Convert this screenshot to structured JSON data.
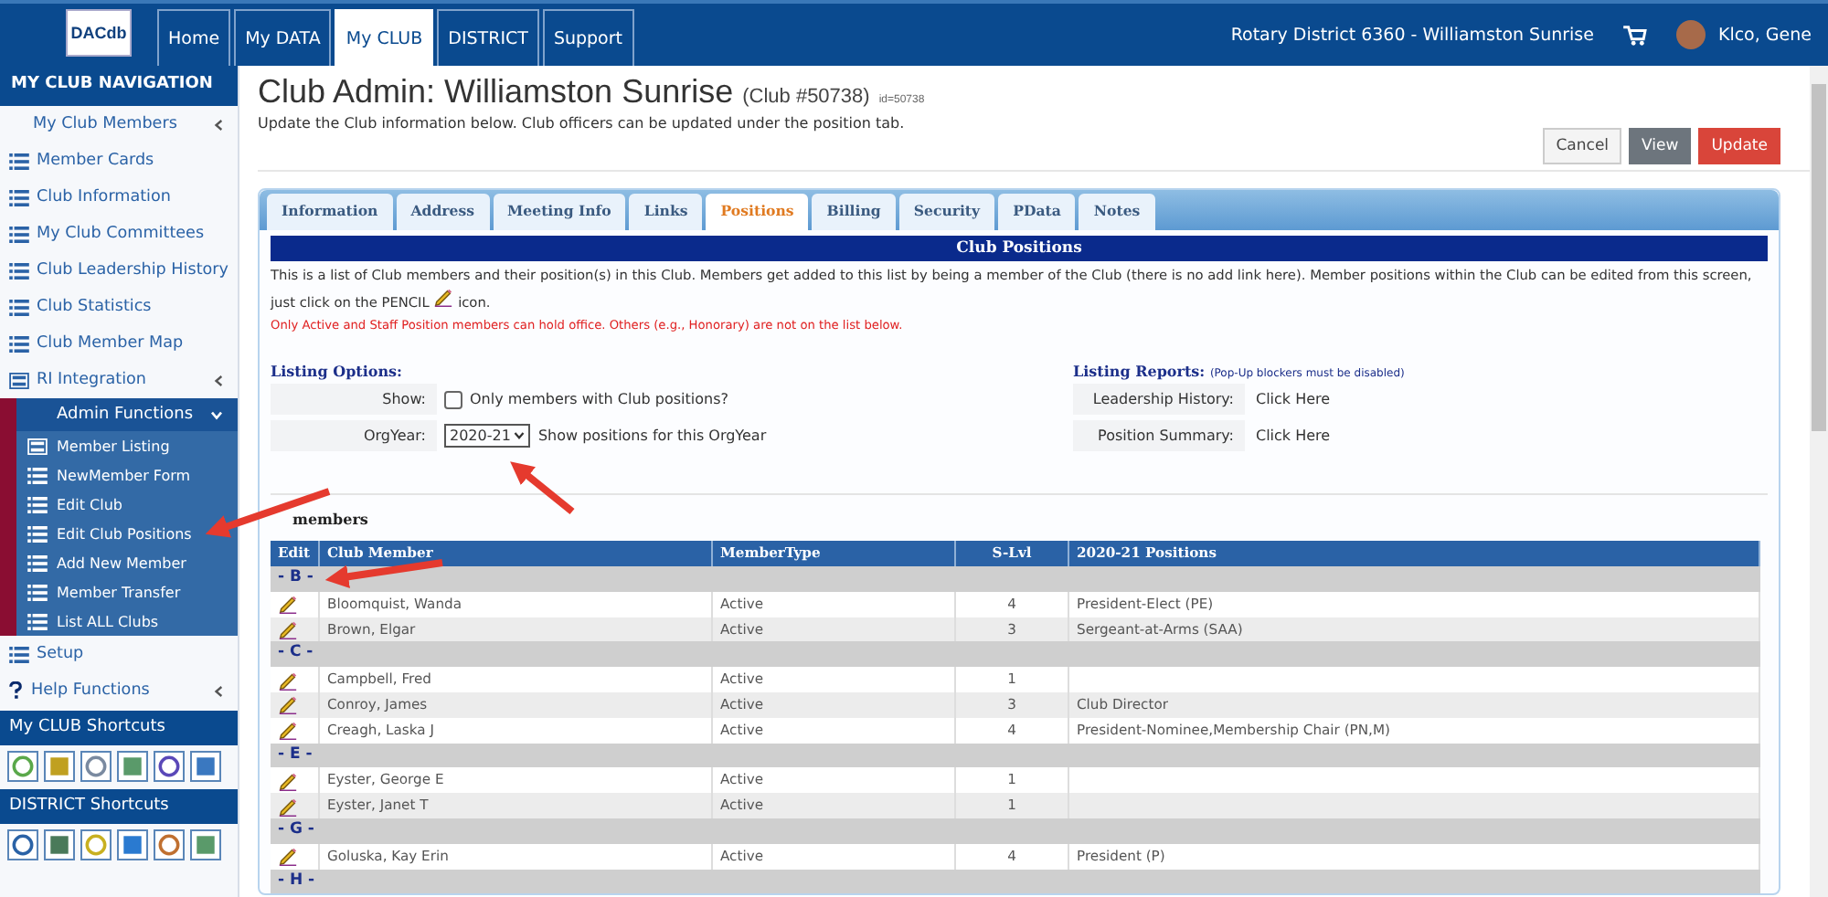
{
  "topbar": {
    "logo": "DACdb",
    "nav": [
      {
        "label": "Home",
        "selected": false
      },
      {
        "label": "My DATA",
        "selected": false
      },
      {
        "label": "My CLUB",
        "selected": true
      },
      {
        "label": "DISTRICT",
        "selected": false
      },
      {
        "label": "Support",
        "selected": false
      }
    ],
    "context": "Rotary District 6360 - Williamston Sunrise",
    "user": "Klco, Gene"
  },
  "sidebar": {
    "heading": "MY CLUB NAVIGATION",
    "items": [
      {
        "label": "My Club Members",
        "kind": "parent"
      },
      {
        "label": "Member Cards",
        "kind": "list"
      },
      {
        "label": "Club Information",
        "kind": "list"
      },
      {
        "label": "My Club Committees",
        "kind": "list"
      },
      {
        "label": "Club Leadership History",
        "kind": "list"
      },
      {
        "label": "Club Statistics",
        "kind": "list"
      },
      {
        "label": "Club Member Map",
        "kind": "list"
      },
      {
        "label": "RI Integration",
        "kind": "card-parent"
      },
      {
        "label": "Admin Functions",
        "kind": "group",
        "expanded": true,
        "children": [
          {
            "label": "Member Listing",
            "kind": "card"
          },
          {
            "label": "NewMember Form",
            "kind": "list"
          },
          {
            "label": "Edit Club",
            "kind": "list"
          },
          {
            "label": "Edit Club Positions",
            "kind": "list"
          },
          {
            "label": "Add New Member",
            "kind": "list"
          },
          {
            "label": "Member Transfer",
            "kind": "list"
          },
          {
            "label": "List ALL Clubs",
            "kind": "list"
          }
        ]
      },
      {
        "label": "Setup",
        "kind": "list"
      },
      {
        "label": "Help Functions",
        "kind": "help-parent"
      }
    ],
    "shortcut_sections": [
      {
        "title": "My CLUB Shortcuts"
      },
      {
        "title": "DISTRICT Shortcuts"
      }
    ]
  },
  "main": {
    "title": "Club Admin: Williamston Sunrise",
    "club_number": "(Club #50738)",
    "club_id": "id=50738",
    "subtitle": "Update the Club information below. Club officers can be updated under the position tab.",
    "buttons": [
      {
        "label": "Cancel",
        "kind": "default"
      },
      {
        "label": "View",
        "kind": "secondary"
      },
      {
        "label": "Update",
        "kind": "danger"
      }
    ],
    "tabs": [
      {
        "label": "Information",
        "selected": false
      },
      {
        "label": "Address",
        "selected": false
      },
      {
        "label": "Meeting Info",
        "selected": false
      },
      {
        "label": "Links",
        "selected": false
      },
      {
        "label": "Positions",
        "selected": true
      },
      {
        "label": "Billing",
        "selected": false
      },
      {
        "label": "Security",
        "selected": false
      },
      {
        "label": "PData",
        "selected": false
      },
      {
        "label": "Notes",
        "selected": false
      }
    ],
    "panel_title": "Club Positions",
    "intro_before": "This is a list of Club members and their position(s) in this Club. Members get added to this list by being a member of the Club (there is no add link here). Member positions within the Club can be edited from this screen, just click on the PENCIL",
    "intro_after": "icon.",
    "warning": "Only Active and Staff Position members can hold office. Others (e.g., Honorary) are not on the list below.",
    "listing_options": {
      "heading": "Listing Options:",
      "show_label": "Show:",
      "show_checkbox": {
        "label": "Only members with Club positions?",
        "checked": false
      },
      "orgyear_label": "OrgYear:",
      "orgyear_value": "2020-21",
      "orgyear_hint": "Show positions for this OrgYear"
    },
    "listing_reports": {
      "heading": "Listing Reports:",
      "note": "(Pop-Up blockers must be disabled)",
      "rows": [
        {
          "label": "Leadership History:",
          "link": "Click Here"
        },
        {
          "label": "Position Summary:",
          "link": "Click Here"
        }
      ]
    },
    "members_caption": "members",
    "table": {
      "columns": [
        "Edit",
        "Club Member",
        "MemberType",
        "S-Lvl",
        "2020-21 Positions"
      ],
      "groups": [
        {
          "letter": "- B -",
          "rows": [
            {
              "name": "Bloomquist, Wanda",
              "type": "Active",
              "level": "4",
              "positions": "President-Elect (PE)"
            },
            {
              "name": "Brown, Elgar",
              "type": "Active",
              "level": "3",
              "positions": "Sergeant-at-Arms (SAA)"
            }
          ]
        },
        {
          "letter": "- C -",
          "rows": [
            {
              "name": "Campbell, Fred",
              "type": "Active",
              "level": "1",
              "positions": ""
            },
            {
              "name": "Conroy, James",
              "type": "Active",
              "level": "3",
              "positions": "Club Director"
            },
            {
              "name": "Creagh, Laska J",
              "type": "Active",
              "level": "4",
              "positions": "President-Nominee,Membership Chair (PN,M)"
            }
          ]
        },
        {
          "letter": "- E -",
          "rows": [
            {
              "name": "Eyster, George E",
              "type": "Active",
              "level": "1",
              "positions": ""
            },
            {
              "name": "Eyster, Janet T",
              "type": "Active",
              "level": "1",
              "positions": ""
            }
          ]
        },
        {
          "letter": "- G -",
          "rows": [
            {
              "name": "Goluska, Kay Erin",
              "type": "Active",
              "level": "4",
              "positions": "President (P)"
            }
          ]
        },
        {
          "letter": "- H -"
        }
      ]
    }
  }
}
